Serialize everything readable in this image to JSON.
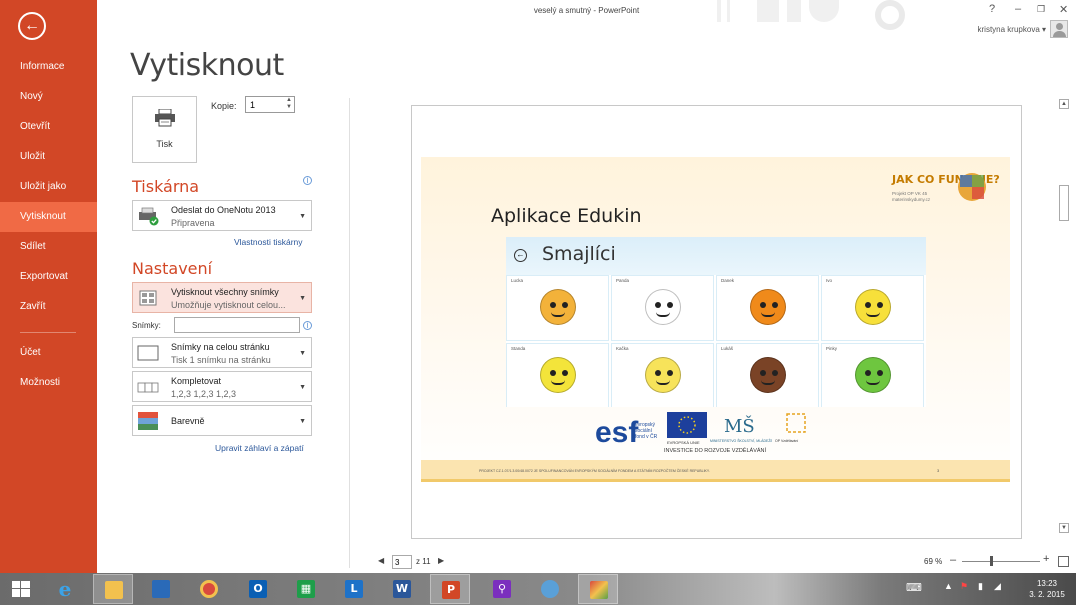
{
  "window": {
    "title": "veselý a smutný - PowerPoint",
    "help": "?",
    "minimize": "–",
    "restore": "❐",
    "close": "✕"
  },
  "user": {
    "name": "kristyna krupkova ▾"
  },
  "nav": {
    "back_glyph": "←",
    "items": [
      "Informace",
      "Nový",
      "Otevřít",
      "Uložit",
      "Uložit jako",
      "Vytisknout",
      "Sdílet",
      "Exportovat",
      "Zavřít"
    ],
    "bottom_items": [
      "Účet",
      "Možnosti"
    ],
    "active": "Vytisknout",
    "accent_color": "#d24726"
  },
  "page_title": "Vytisknout",
  "print": {
    "button_label": "Tisk",
    "copies_label": "Kopie:",
    "copies_value": "1"
  },
  "printer": {
    "heading": "Tiskárna",
    "name": "Odeslat do OneNotu 2013",
    "status": "Připravena",
    "properties_link": "Vlastnosti tiskárny"
  },
  "settings": {
    "heading": "Nastavení",
    "range_title": "Vytisknout všechny snímky",
    "range_desc": "Umožňuje vytisknout celou...",
    "slides_label": "Snímky:",
    "slides_value": "",
    "layout_title": "Snímky na celou stránku",
    "layout_desc": "Tisk 1 snímku na stránku",
    "collate_title": "Kompletovat",
    "collate_desc": "1,2,3   1,2,3   1,2,3",
    "color_title": "Barevně",
    "header_footer_link": "Upravit záhlaví a zápatí"
  },
  "slide": {
    "title": "Aplikace Edukin",
    "logo_text": "JAK CO FUNGUJE?",
    "logo_sub": "Projekt OP VK 45 materinskydumy.cz",
    "app_title": "Smajlíci",
    "faces": [
      {
        "name": "Lucka",
        "color": "#f3b23a"
      },
      {
        "name": "Panda",
        "color": "#ffffff"
      },
      {
        "name": "Danek",
        "color": "#f08a1a"
      },
      {
        "name": "Ivo",
        "color": "#f7e03a"
      },
      {
        "name": "Standa",
        "color": "#f3e43a"
      },
      {
        "name": "Kačka",
        "color": "#f7e35a"
      },
      {
        "name": "Lukáš",
        "color": "#7a4326"
      },
      {
        "name": "Pinky",
        "color": "#6ec63f"
      }
    ],
    "logos_caption": "INVESTICE DO ROZVOJE VZDĚLÁVÁNÍ",
    "footer_text": "PROJEKT CZ.1.07/1.3.00/48.0072 JE SPOLUFINANCOVÁN EVROPSKÝM SOCIÁLNÍM FONDEM A STÁTNÍM ROZPOČTEM ČESKÉ REPUBLIKY.",
    "footer_num": "3"
  },
  "pager": {
    "prev": "◀",
    "current": "3",
    "of": "z 11",
    "next": "▶"
  },
  "zoom": {
    "percent": "69 %",
    "minus": "–",
    "plus": "+"
  },
  "taskbar": {
    "apps": [
      "start",
      "internet-explorer",
      "file-explorer",
      "remote-desktop",
      "chrome",
      "outlook",
      "store",
      "lync",
      "word",
      "powerpoint",
      "search",
      "paint",
      "unknown-app"
    ],
    "clock_time": "13:23",
    "clock_date": "3. 2. 2015"
  }
}
